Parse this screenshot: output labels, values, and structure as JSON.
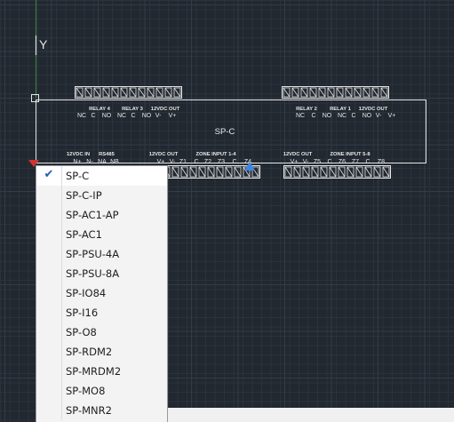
{
  "drawing": {
    "axis_label": "Y",
    "device_label": "SP-C",
    "left_top_groups": [
      "RELAY 4",
      "RELAY 3",
      "12VDC OUT"
    ],
    "left_top_pins": [
      "NC",
      "C",
      "NO",
      "NC",
      "C",
      "NO",
      "V-",
      "V+"
    ],
    "right_top_groups": [
      "RELAY 2",
      "RELAY 1",
      "12VDC OUT"
    ],
    "right_top_pins": [
      "NC",
      "C",
      "NO",
      "NC",
      "C",
      "NO",
      "V-",
      "V+"
    ],
    "left_bottom_groups": [
      "12VDC IN",
      "RS485",
      "12VDC OUT",
      "ZONE INPUT 1-4"
    ],
    "left_bottom_pins": [
      "N+",
      "N-",
      "NA",
      "NB",
      "V+",
      "V-",
      "Z1",
      "C",
      "Z2",
      "Z3",
      "C",
      "Z4"
    ],
    "right_bottom_groups": [
      "12VDC OUT",
      "ZONE INPUT 5-8"
    ],
    "right_bottom_pins": [
      "V+",
      "V-",
      "Z5",
      "C",
      "Z6",
      "Z7",
      "C",
      "Z8"
    ]
  },
  "dropdown": {
    "selected": "SP-C",
    "items": [
      "SP-C",
      "SP-C-IP",
      "SP-AC1-AP",
      "SP-AC1",
      "SP-PSU-4A",
      "SP-PSU-8A",
      "SP-IO84",
      "SP-I16",
      "SP-O8",
      "SP-RDM2",
      "SP-MRDM2",
      "SP-MO8",
      "SP-MNR2"
    ]
  },
  "colors": {
    "background": "#212830",
    "grid_minor": "#2a323b",
    "grid_major": "#333c47",
    "y_axis": "#3c8c3c",
    "linework": "#e6e6e6",
    "grip_blue": "#3d86e0",
    "grip_red": "#d23232",
    "check": "#1a5bb8"
  }
}
